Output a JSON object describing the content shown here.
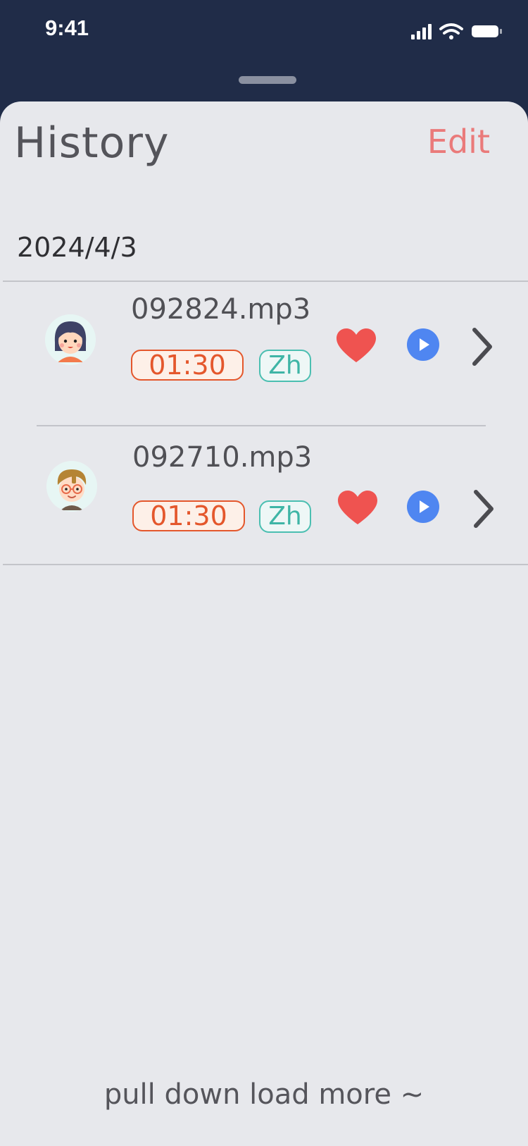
{
  "status_bar": {
    "time": "9:41",
    "icons": [
      "signal-icon",
      "wifi-icon",
      "battery-icon"
    ]
  },
  "header": {
    "title": "History",
    "edit_label": "Edit"
  },
  "date_header": "2024/4/3",
  "items": [
    {
      "filename": "092824.mp3",
      "duration": "01:30",
      "language": "Zh",
      "favorited": true,
      "avatar": "girl-avatar"
    },
    {
      "filename": "092710.mp3",
      "duration": "01:30",
      "language": "Zh",
      "favorited": true,
      "avatar": "boy-avatar"
    }
  ],
  "footer": {
    "text": "pull down load more ~"
  },
  "colors": {
    "top_bar": "#202c48",
    "sheet": "#e7e8ec",
    "accent_edit": "#ea7a7a",
    "heart": "#ef5350",
    "play": "#4f86f1",
    "duration": "#e4572c",
    "language": "#3fb5a6"
  }
}
